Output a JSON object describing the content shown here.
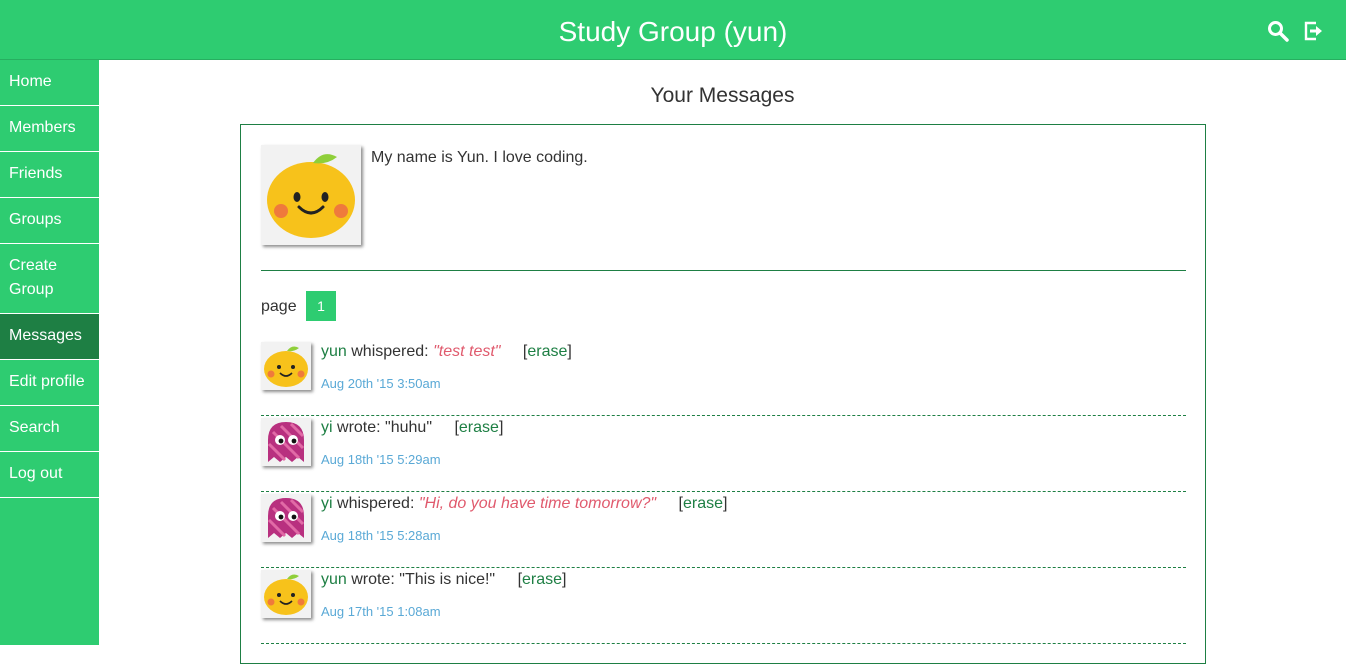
{
  "header": {
    "title": "Study Group (yun)",
    "search_icon": "search-icon",
    "logout_icon": "logout-icon"
  },
  "sidebar": {
    "items": [
      {
        "label": "Home"
      },
      {
        "label": "Members"
      },
      {
        "label": "Friends"
      },
      {
        "label": "Groups"
      },
      {
        "label": "Create Group"
      },
      {
        "label": "Messages",
        "active": true
      },
      {
        "label": "Edit profile"
      },
      {
        "label": "Search"
      },
      {
        "label": "Log out"
      }
    ]
  },
  "main": {
    "title": "Your Messages",
    "profile_text": "My name is Yun. I love coding.",
    "page_label": "page",
    "current_page": "1",
    "messages": [
      {
        "author": "yun",
        "verb": "whispered:",
        "text": "\"test test\"",
        "private": true,
        "erase": "erase",
        "date": "Aug 20th '15 3:50am",
        "avatar": "orange"
      },
      {
        "author": "yi",
        "verb": "wrote:",
        "text": "\"huhu\"",
        "private": false,
        "erase": "erase",
        "date": "Aug 18th '15 5:29am",
        "avatar": "ghost"
      },
      {
        "author": "yi",
        "verb": "whispered:",
        "text": "\"Hi, do you have time tomorrow?\"",
        "private": true,
        "erase": "erase",
        "date": "Aug 18th '15 5:28am",
        "avatar": "ghost"
      },
      {
        "author": "yun",
        "verb": "wrote:",
        "text": "\"This is nice!\"",
        "private": false,
        "erase": "erase",
        "date": "Aug 17th '15 1:08am",
        "avatar": "orange"
      }
    ]
  },
  "colors": {
    "brand": "#2ecc71",
    "active": "#1e7f44",
    "private": "#e05a6d",
    "date": "#5aa9d6"
  }
}
